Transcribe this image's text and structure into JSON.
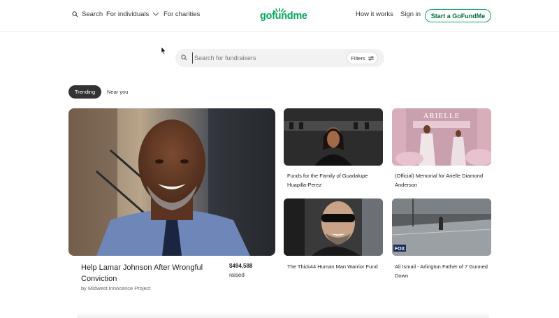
{
  "header": {
    "search_label": "Search",
    "for_individuals_label": "For individuals",
    "for_charities_label": "For charities",
    "logo_text": "gofundme",
    "how_it_works_label": "How it works",
    "sign_in_label": "Sign in",
    "start_button_label": "Start a GoFundMe"
  },
  "search": {
    "placeholder": "Search for fundraisers",
    "filters_label": "Filters"
  },
  "tabs": [
    {
      "label": "Trending",
      "active": true
    },
    {
      "label": "Near you",
      "active": false
    }
  ],
  "featured": {
    "title": "Help Lamar Johnson After Wrongful Conviction",
    "organizer": "by Midwest Innocence Project",
    "amount": "$494,588",
    "raised_label": "raised"
  },
  "cards": [
    {
      "title": "Funds for the Family of Guadalupe Huapilla-Perez"
    },
    {
      "title": "(Official) Memorial for Arielle Diamond Anderson"
    },
    {
      "title": "The Thick44 Human Man Warrior Fund"
    },
    {
      "title": "Ali Ismail - Arlington Father of 7 Gunned Down"
    }
  ],
  "card_images": {
    "memorial_banner_text": "ARIELLE",
    "news_logo_text": "FOX"
  },
  "colors": {
    "brand_green": "#02a95c",
    "dark_green": "#026d3f",
    "tab_active_bg": "#333333"
  }
}
